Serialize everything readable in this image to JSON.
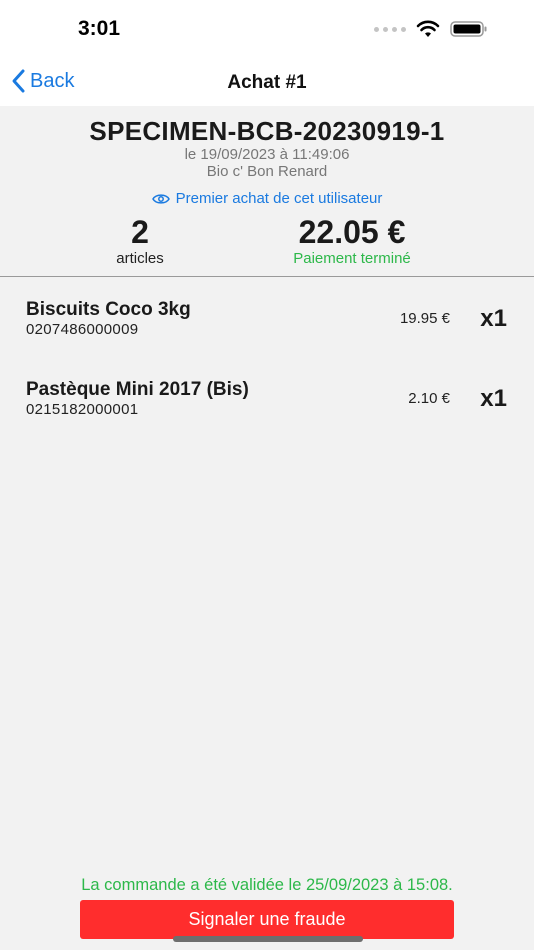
{
  "status_bar": {
    "time": "3:01"
  },
  "nav": {
    "back_label": "Back",
    "title": "Achat #1"
  },
  "order": {
    "id": "SPECIMEN-BCB-20230919-1",
    "date": "le 19/09/2023 à 11:49:06",
    "shop": "Bio c' Bon Renard",
    "first_purchase_note": "Premier achat de cet utilisateur",
    "article_count": "2",
    "article_label": "articles",
    "total": "22.05 €",
    "payment_status": "Paiement terminé"
  },
  "items": [
    {
      "name": "Biscuits Coco 3kg",
      "code": "0207486000009",
      "price": "19.95 €",
      "qty": "x1"
    },
    {
      "name": "Pastèque Mini 2017 (Bis)",
      "code": "0215182000001",
      "price": "2.10 €",
      "qty": "x1"
    }
  ],
  "footer": {
    "validated_text": "La commande a été validée le 25/09/2023 à 15:08.",
    "fraud_button_label": "Signaler une fraude"
  },
  "colors": {
    "accent": "#1a7ae0",
    "success": "#2db84a",
    "danger": "#ff2d2d",
    "background": "#f2f2f2"
  },
  "icons": {
    "back": "chevron-left-icon",
    "eye": "eye-icon",
    "wifi": "wifi-icon",
    "battery": "battery-icon",
    "signal": "signal-icon"
  }
}
